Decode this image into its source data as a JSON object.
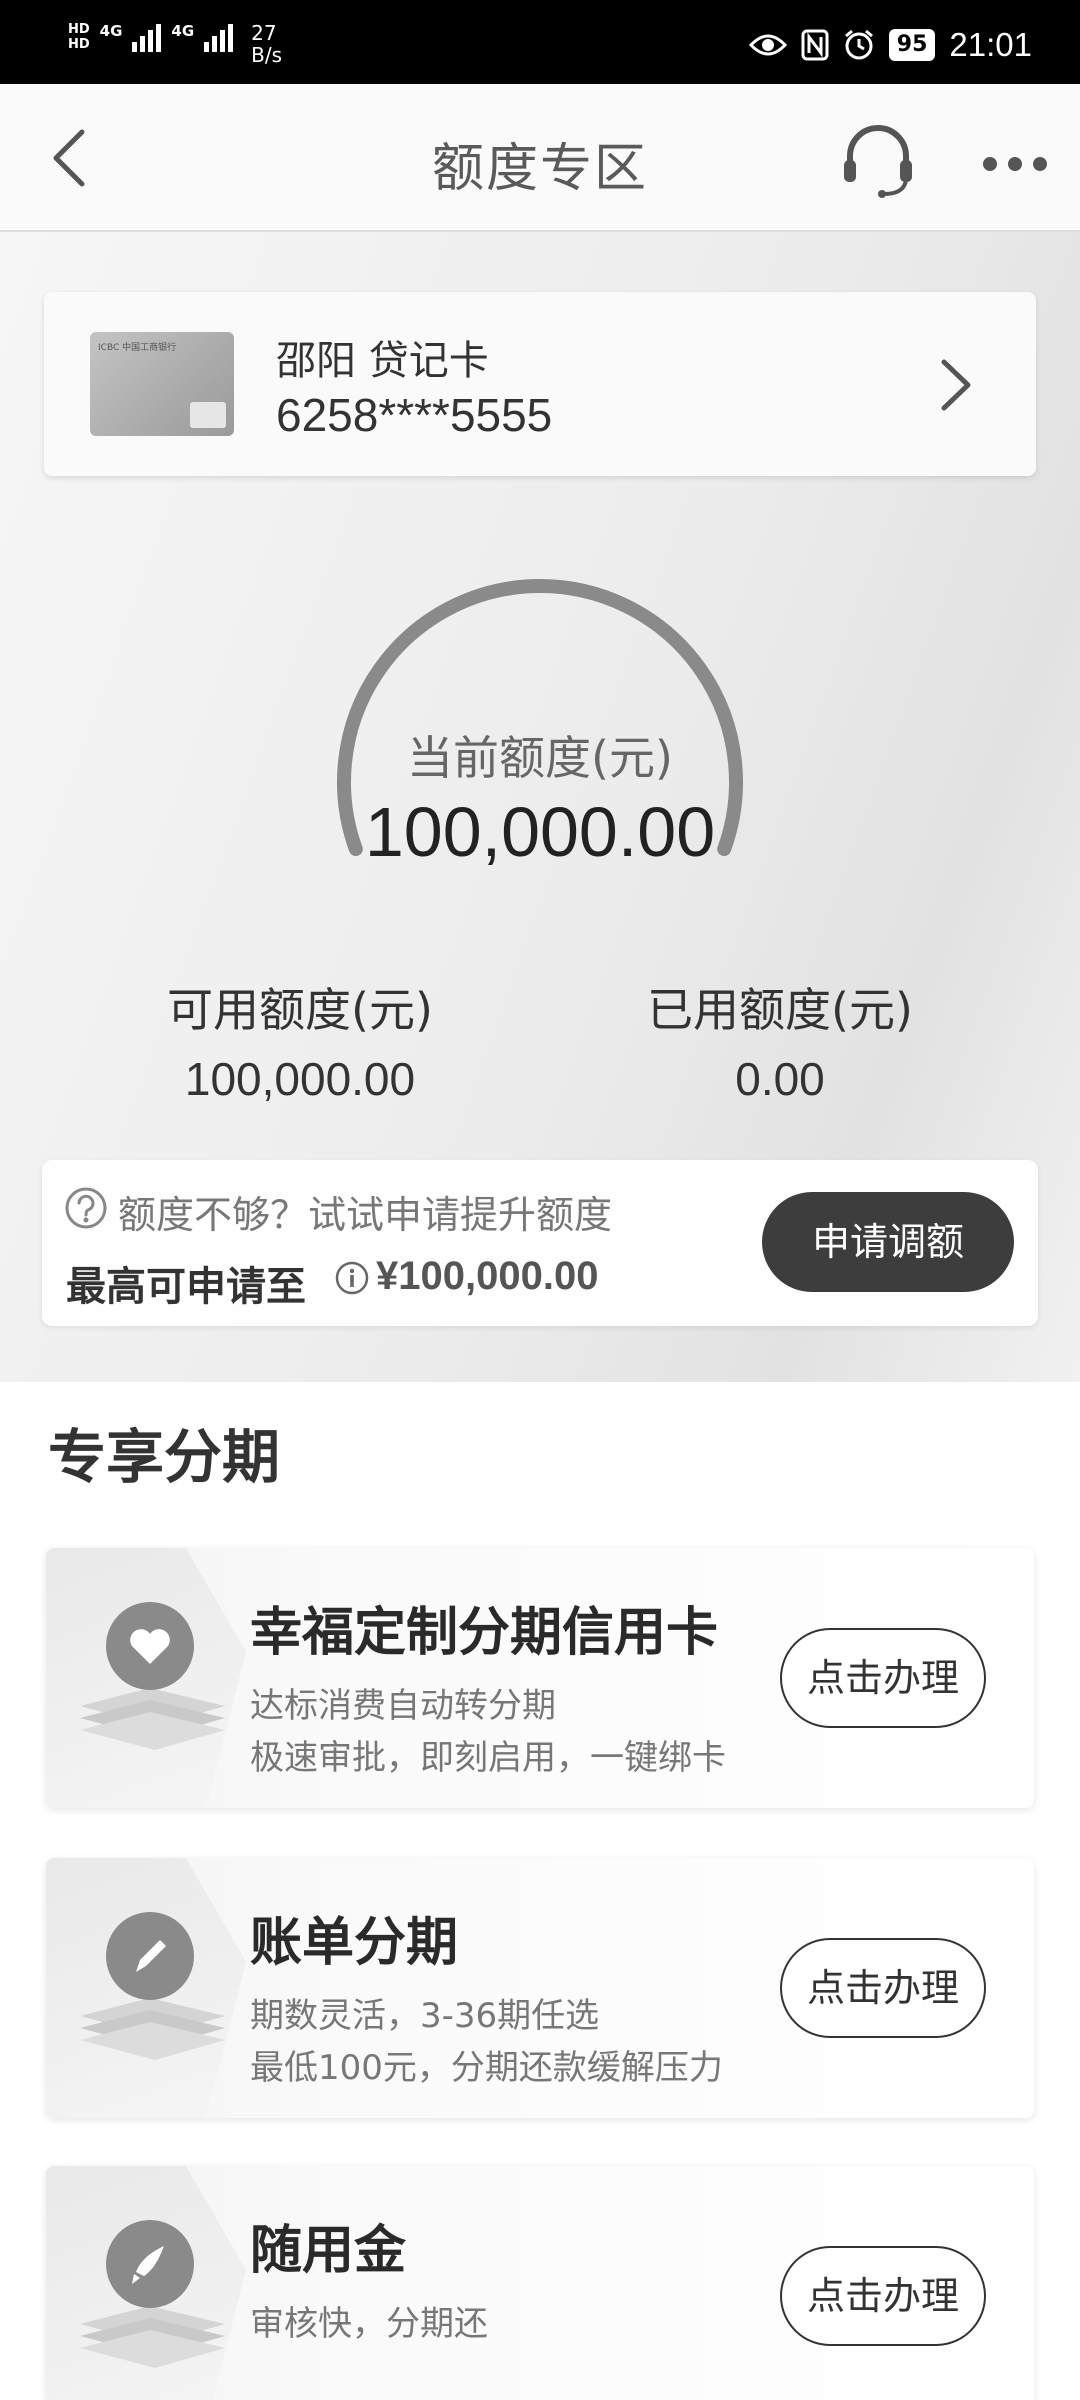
{
  "status_bar": {
    "hd_top": "HD",
    "hd_bottom": "HD",
    "net1": "4G",
    "net2": "4G",
    "speed_value": "27",
    "speed_unit": "B/s",
    "battery": "95",
    "time": "21:01"
  },
  "nav": {
    "title": "额度专区"
  },
  "card": {
    "name": "邵阳 贷记卡",
    "number": "6258****5555",
    "logo_text": "ICBC 中国工商银行"
  },
  "gauge": {
    "label": "当前额度(元)",
    "value": "100,000.00",
    "used_fraction": 0.0
  },
  "quota": {
    "available_label": "可用额度(元)",
    "available_value": "100,000.00",
    "used_label": "已用额度(元)",
    "used_value": "0.00"
  },
  "apply": {
    "tip": "额度不够？试试申请提升额度",
    "max_label": "最高可申请至",
    "max_value": "¥100,000.00",
    "button": "申请调额"
  },
  "section": {
    "title": "专享分期"
  },
  "promos": [
    {
      "title": "幸福定制分期信用卡",
      "desc1": "达标消费自动转分期",
      "desc2": "极速审批，即刻启用，一键绑卡",
      "button": "点击办理",
      "icon": "heart-icon"
    },
    {
      "title": "账单分期",
      "desc1": "期数灵活，3-36期任选",
      "desc2": "最低100元，分期还款缓解压力",
      "button": "点击办理",
      "icon": "pencil-icon"
    },
    {
      "title": "随用金",
      "desc1": "审核快，分期还",
      "desc2": "",
      "button": "点击办理",
      "icon": "rocket-icon"
    }
  ]
}
